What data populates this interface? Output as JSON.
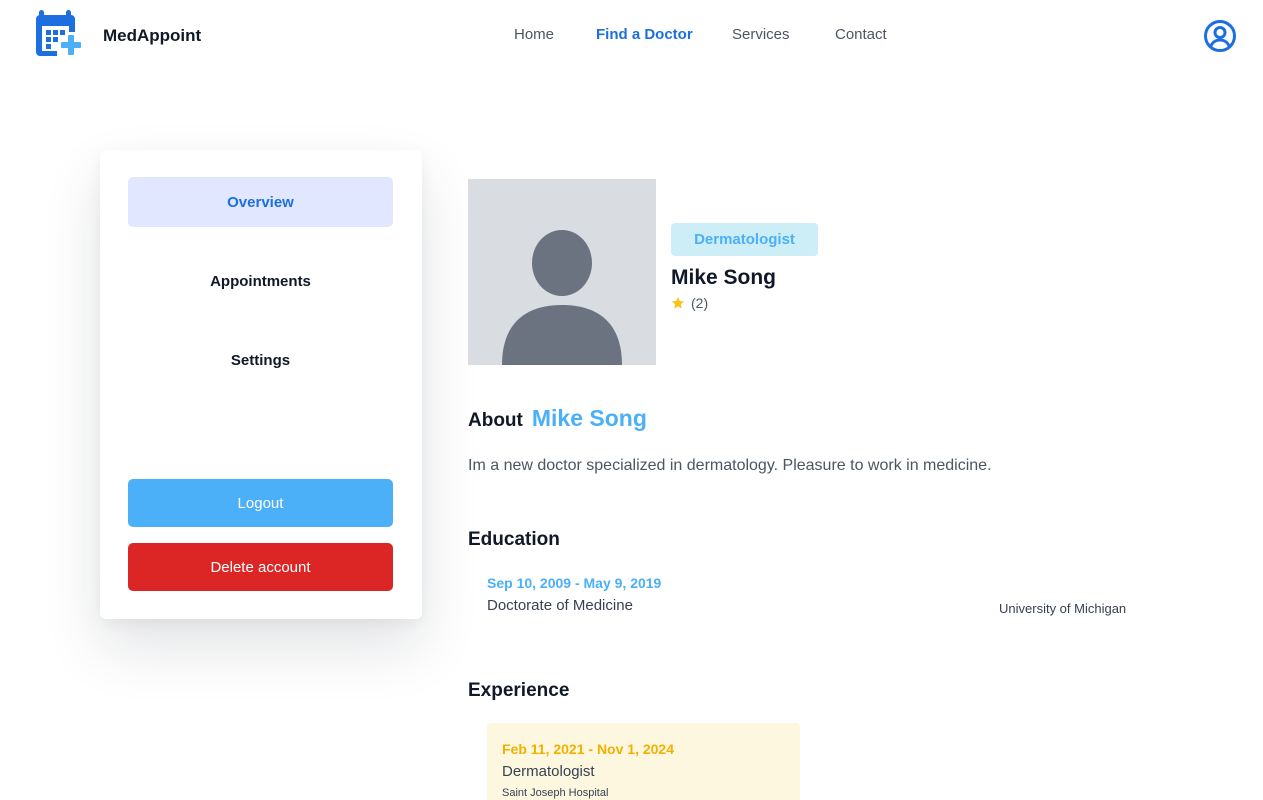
{
  "app": {
    "brand": "MedAppoint",
    "brand_color": "#1d6fe0"
  },
  "nav": {
    "items": [
      {
        "label": "Home",
        "active": false
      },
      {
        "label": "Find a Doctor",
        "active": true
      },
      {
        "label": "Services",
        "active": false
      },
      {
        "label": "Contact",
        "active": false
      }
    ],
    "profile_icon": "user-circle-icon"
  },
  "sidebar": {
    "items": [
      {
        "label": "Overview",
        "active": true
      },
      {
        "label": "Appointments",
        "active": false
      },
      {
        "label": "Settings",
        "active": false
      }
    ],
    "logout_label": "Logout",
    "delete_label": "Delete account"
  },
  "doctor": {
    "specialty": "Dermatologist",
    "name": "Mike Song",
    "rating_count": "(2)",
    "rating_icon": "star-icon",
    "photo_icon": "avatar-placeholder-icon",
    "about_label": "About",
    "about_name": "Mike Song",
    "about_text": "Im a new doctor specialized in dermatology. Pleasure to work in medicine."
  },
  "education": {
    "title": "Education",
    "entries": [
      {
        "dates": "Sep 10, 2009 - May 9, 2019",
        "degree": "Doctorate of Medicine",
        "school": "University of Michigan"
      }
    ]
  },
  "experience": {
    "title": "Experience",
    "entries": [
      {
        "dates": "Feb 11, 2021 - Nov 1, 2024",
        "role": "Dermatologist",
        "place": "Saint Joseph Hospital"
      }
    ]
  },
  "colors": {
    "accent_blue": "#1d6fe0",
    "light_blue": "#4bb0f7",
    "active_item_bg": "#e0e7ff",
    "delete_red": "#dc2626",
    "badge_bg": "#cdeef6",
    "experience_bg": "#fef7e0",
    "experience_date": "#f0b100",
    "star": "#f5c518"
  }
}
